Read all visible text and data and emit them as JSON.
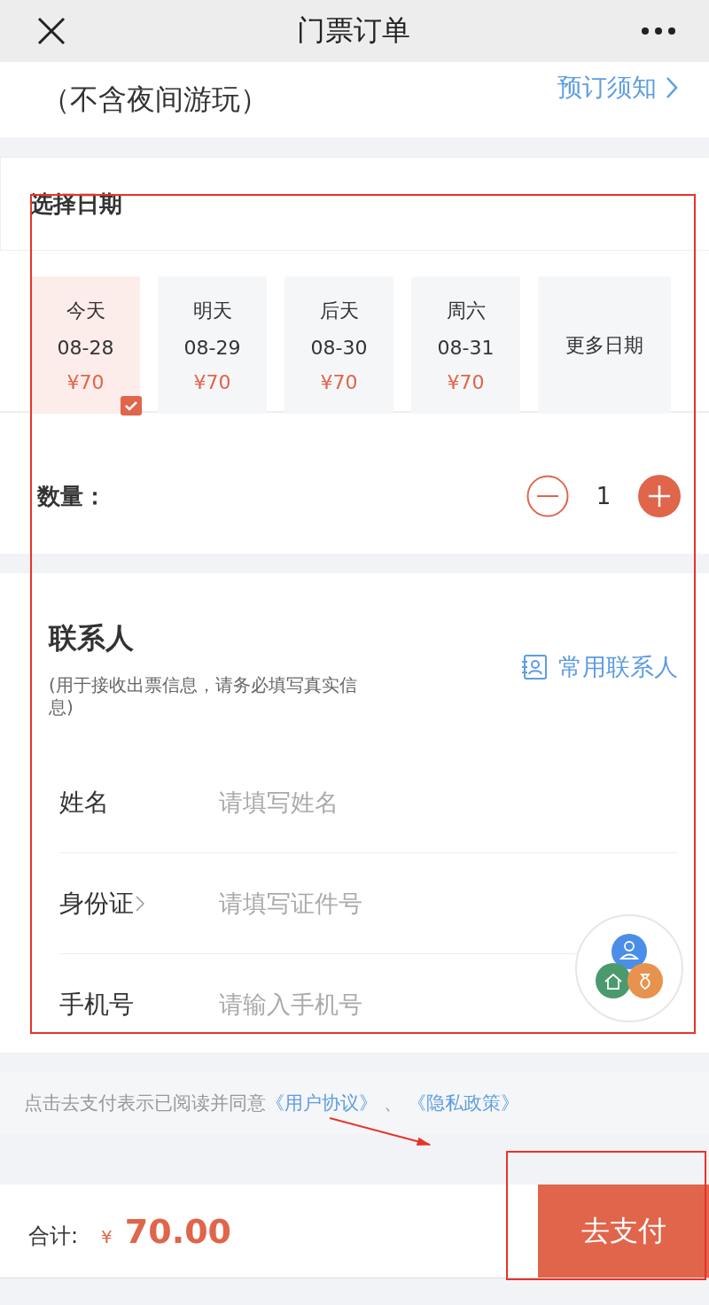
{
  "header": {
    "title": "门票订单"
  },
  "ticket": {
    "name_lines": [
      "（不含夜间游玩）"
    ],
    "notice_link": "预订须知"
  },
  "date_section": {
    "title": "选择日期",
    "dates": [
      {
        "kind": "day",
        "day": "今天",
        "date": "08-28",
        "price": "¥70",
        "selected": true
      },
      {
        "kind": "day",
        "day": "明天",
        "date": "08-29",
        "price": "¥70",
        "selected": false
      },
      {
        "kind": "day",
        "day": "后天",
        "date": "08-30",
        "price": "¥70",
        "selected": false
      },
      {
        "kind": "day",
        "day": "周六",
        "date": "08-31",
        "price": "¥70",
        "selected": false
      },
      {
        "kind": "more",
        "label": "更多日期",
        "selected": false
      }
    ]
  },
  "quantity": {
    "label": "数量：",
    "value": "1"
  },
  "contact": {
    "title": "联系人",
    "hint": "(用于接收出票信息，请务必填写真实信息)",
    "contacts_link": "常用联系人",
    "fields": [
      {
        "kind": "text",
        "label": "姓名",
        "placeholder": "请填写姓名"
      },
      {
        "kind": "select",
        "label": "身份证",
        "placeholder": "请填写证件号"
      },
      {
        "kind": "text",
        "label": "手机号",
        "placeholder": "请输入手机号"
      }
    ]
  },
  "agreement": {
    "text": "点击去支付表示已阅读并同意",
    "links": [
      "《用户协议》",
      "《隐私政策》"
    ],
    "separator": "、"
  },
  "footer": {
    "total_label": "合计:",
    "currency": "¥",
    "amount": "70.00",
    "pay_button": "去支付"
  },
  "annotations": [
    {
      "kind": "rect"
    },
    {
      "kind": "rect"
    },
    {
      "kind": "arrow"
    }
  ]
}
